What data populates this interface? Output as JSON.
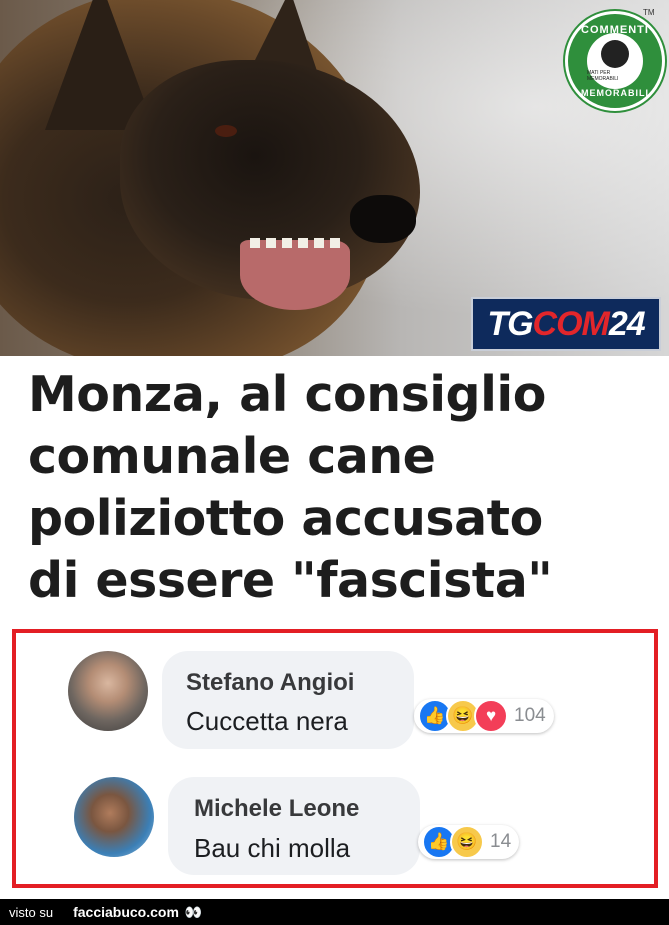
{
  "badge": {
    "top_text": "COMMENTI",
    "bottom_text": "MEMORABILI",
    "inner_text": "MATI PER MEMORABILI",
    "tm": "TM",
    "color": "#2f8f3c"
  },
  "tgcom": {
    "part1": "TG",
    "part2": "COM",
    "part3": "24"
  },
  "headline": "Monza, al consiglio\ncomunale cane\npoliziotto accusato\ndi essere \"fascista\"",
  "comments": [
    {
      "name": "Stefano Angioi",
      "text": "Cuccetta nera",
      "reactions": [
        "like-icon",
        "haha-icon",
        "love-icon"
      ],
      "count": "104"
    },
    {
      "name": "Michele Leone",
      "text": "Bau chi molla",
      "reactions": [
        "like-icon",
        "haha-icon"
      ],
      "count": "14"
    }
  ],
  "footer": {
    "visto": "visto su",
    "site": "facciabuco.com",
    "icon": "eyes-icon"
  },
  "colors": {
    "highlight_border": "#e31e24",
    "like": "#1877f2",
    "love": "#f33e58",
    "haha": "#f7c94b"
  }
}
